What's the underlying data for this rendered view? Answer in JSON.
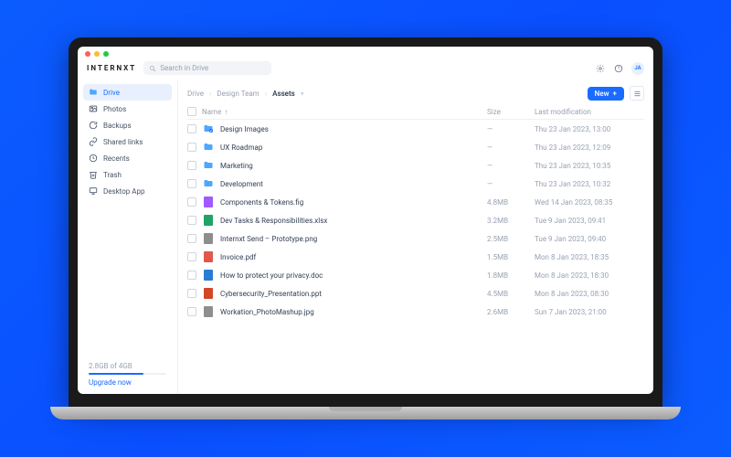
{
  "brand": "INTERNXT",
  "search": {
    "placeholder": "Search in Drive"
  },
  "avatar": "JA",
  "sidebar": {
    "items": [
      {
        "label": "Drive"
      },
      {
        "label": "Photos"
      },
      {
        "label": "Backups"
      },
      {
        "label": "Shared links"
      },
      {
        "label": "Recents"
      },
      {
        "label": "Trash"
      },
      {
        "label": "Desktop App"
      }
    ],
    "storage": "2.8GB of 4GB",
    "upgrade": "Upgrade now"
  },
  "breadcrumb": {
    "a": "Drive",
    "b": "Design Team",
    "c": "Assets"
  },
  "newbtn": "New",
  "columns": {
    "name": "Name",
    "size": "Size",
    "mod": "Last modification"
  },
  "rows": [
    {
      "name": "Design Images",
      "size": "—",
      "mod": "Thu 23 Jan 2023, 13:00",
      "kind": "folder",
      "badge": true
    },
    {
      "name": "UX Roadmap",
      "size": "—",
      "mod": "Thu 23 Jan 2023, 12:09",
      "kind": "folder"
    },
    {
      "name": "Marketing",
      "size": "—",
      "mod": "Thu 23 Jan 2023, 10:35",
      "kind": "folder"
    },
    {
      "name": "Development",
      "size": "—",
      "mod": "Thu 23 Jan 2023, 10:32",
      "kind": "folder"
    },
    {
      "name": "Components & Tokens.fig",
      "size": "4.8MB",
      "mod": "Wed 14 Jan 2023, 08:35",
      "kind": "fig"
    },
    {
      "name": "Dev Tasks & Responsibilities.xlsx",
      "size": "3.2MB",
      "mod": "Tue 9 Jan 2023, 09:41",
      "kind": "xls"
    },
    {
      "name": "Internxt Send – Prototype.png",
      "size": "2.5MB",
      "mod": "Tue 9 Jan 2023, 09:40",
      "kind": "img"
    },
    {
      "name": "Invoice.pdf",
      "size": "1.5MB",
      "mod": "Mon 8 Jan 2023, 18:35",
      "kind": "pdf"
    },
    {
      "name": "How to protect your privacy.doc",
      "size": "1.8MB",
      "mod": "Mon 8 Jan 2023, 18:30",
      "kind": "doc"
    },
    {
      "name": "Cybersecurity_Presentation.ppt",
      "size": "4.5MB",
      "mod": "Mon 8 Jan 2023, 08:30",
      "kind": "ppt"
    },
    {
      "name": "Workation_PhotoMashup.jpg",
      "size": "2.6MB",
      "mod": "Sun 7 Jan 2023, 21:00",
      "kind": "img"
    }
  ]
}
